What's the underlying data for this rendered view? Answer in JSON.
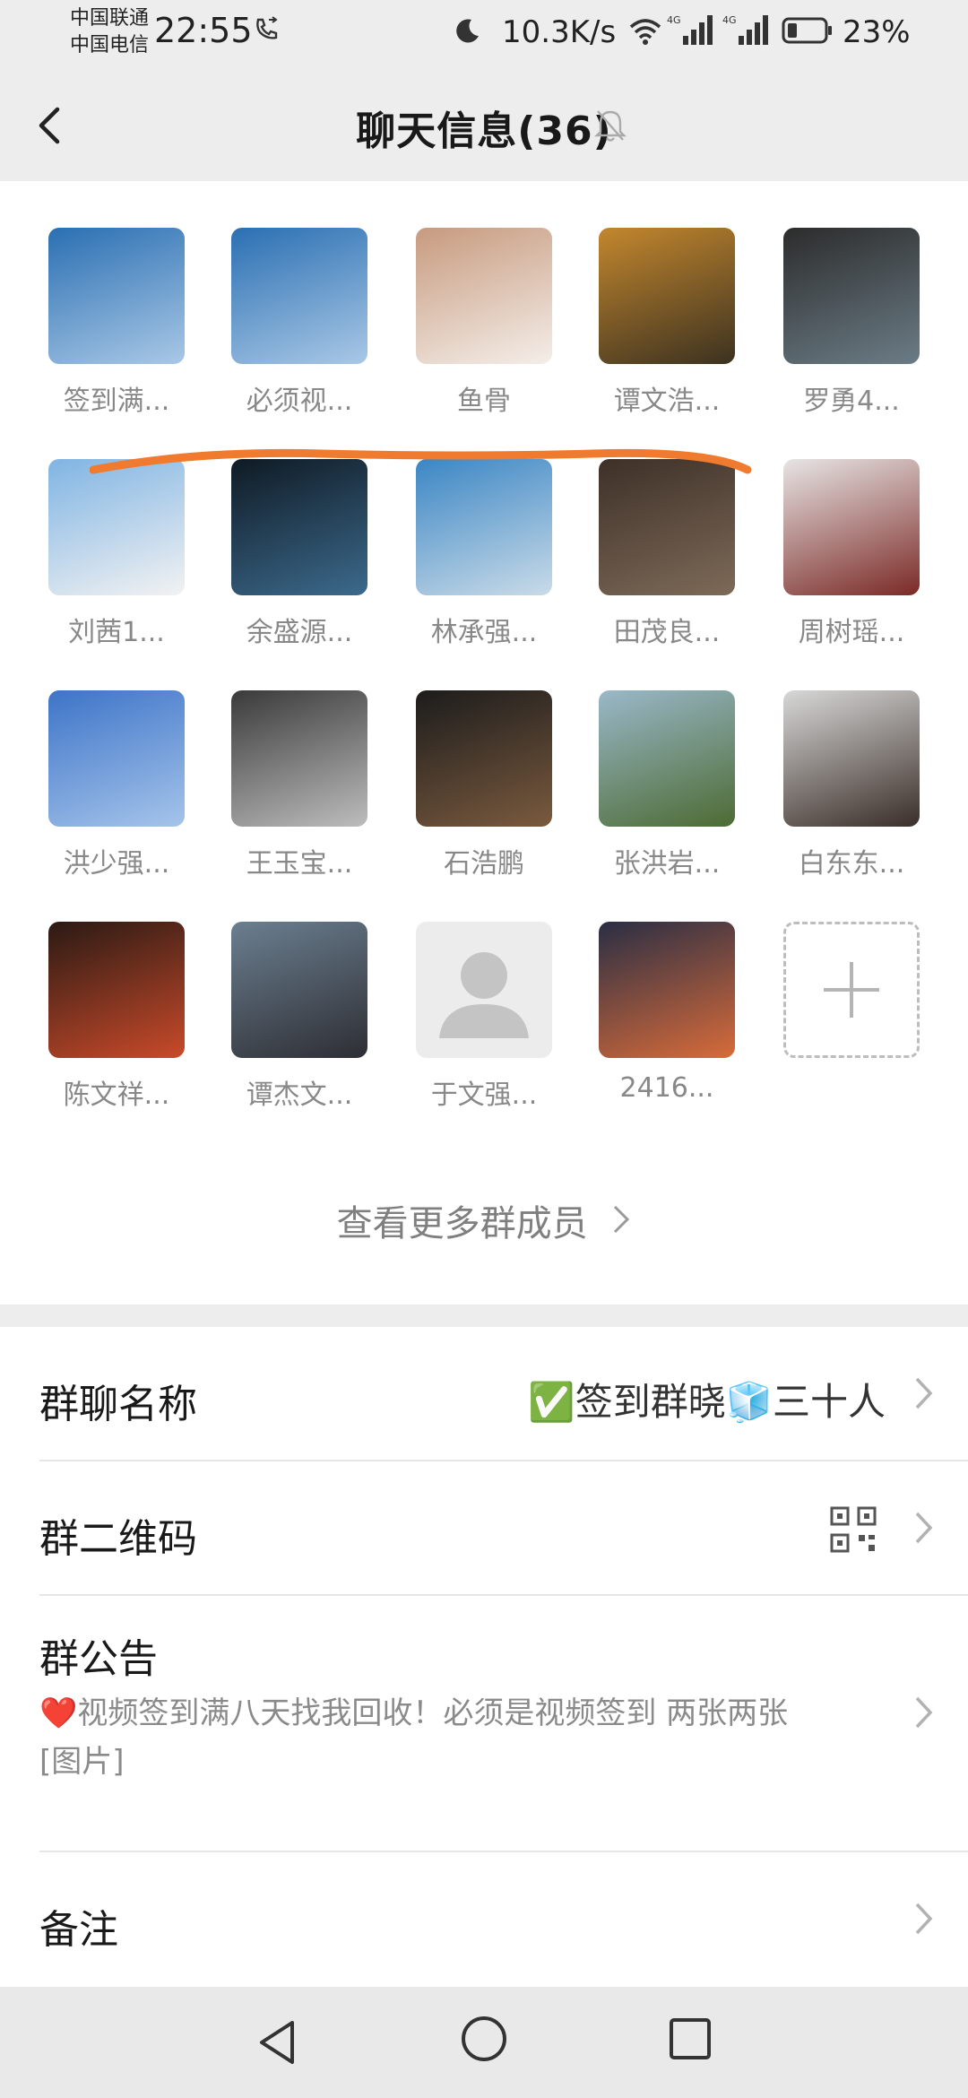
{
  "status_bar": {
    "carrier1": "中国联通",
    "carrier2": "中国电信",
    "time": "22:55",
    "speed": "10.3K/s",
    "net1": "4G",
    "net2": "4G",
    "battery": "23%"
  },
  "header": {
    "title": "聊天信息(36)"
  },
  "members": [
    {
      "name": "签到满...",
      "colors": [
        "#2a6fb2",
        "#a9c8e6"
      ]
    },
    {
      "name": "必须视...",
      "colors": [
        "#2a6fb2",
        "#a9c8e6"
      ]
    },
    {
      "name": "鱼骨",
      "colors": [
        "#c79a7e",
        "#f4eee9"
      ]
    },
    {
      "name": "谭文浩...",
      "colors": [
        "#c3872e",
        "#3c3220"
      ]
    },
    {
      "name": "罗勇4...",
      "colors": [
        "#2c2c2c",
        "#6b7c86"
      ]
    },
    {
      "name": "刘茜1...",
      "colors": [
        "#7fb4e3",
        "#f2f2f2"
      ]
    },
    {
      "name": "余盛源...",
      "colors": [
        "#0f1a24",
        "#3c6a8c"
      ]
    },
    {
      "name": "林承强...",
      "colors": [
        "#3b86c4",
        "#c9dbe8"
      ]
    },
    {
      "name": "田茂良...",
      "colors": [
        "#3e3028",
        "#7d6a58"
      ]
    },
    {
      "name": "周树瑶...",
      "colors": [
        "#e7e5e5",
        "#7b2a26"
      ]
    },
    {
      "name": "洪少强...",
      "colors": [
        "#3d74c8",
        "#a5c4ea"
      ]
    },
    {
      "name": "王玉宝...",
      "colors": [
        "#3a3a3a",
        "#bdbdbd"
      ]
    },
    {
      "name": "石浩鹏",
      "colors": [
        "#1c1c1c",
        "#7a5a3e"
      ]
    },
    {
      "name": "张洪岩...",
      "colors": [
        "#9ab8c9",
        "#4d6b33"
      ]
    },
    {
      "name": "白东东...",
      "colors": [
        "#d8d8d8",
        "#3a2e28"
      ]
    },
    {
      "name": "陈文祥...",
      "colors": [
        "#2a1a14",
        "#c94a2a"
      ]
    },
    {
      "name": "谭杰文...",
      "colors": [
        "#6b7f90",
        "#2e2e34"
      ]
    },
    {
      "name": "于文强...",
      "colors": [
        "#ececec",
        "#c8c8c8"
      ]
    },
    {
      "name": "2416...",
      "colors": [
        "#2a2e44",
        "#d76b3a"
      ]
    }
  ],
  "more_link": "查看更多群成员",
  "settings": {
    "group_name_label": "群聊名称",
    "group_name_value": "✅签到群晓🧊三十人",
    "qr_label": "群二维码",
    "notice_label": "群公告",
    "notice_text": "❤️视频签到满八天找我回收！必须是视频签到 两张两张",
    "notice_image": "[图片]",
    "remark_label": "备注"
  },
  "colors": {
    "highlight_line": "#f07a2e",
    "background": "#ededed"
  }
}
